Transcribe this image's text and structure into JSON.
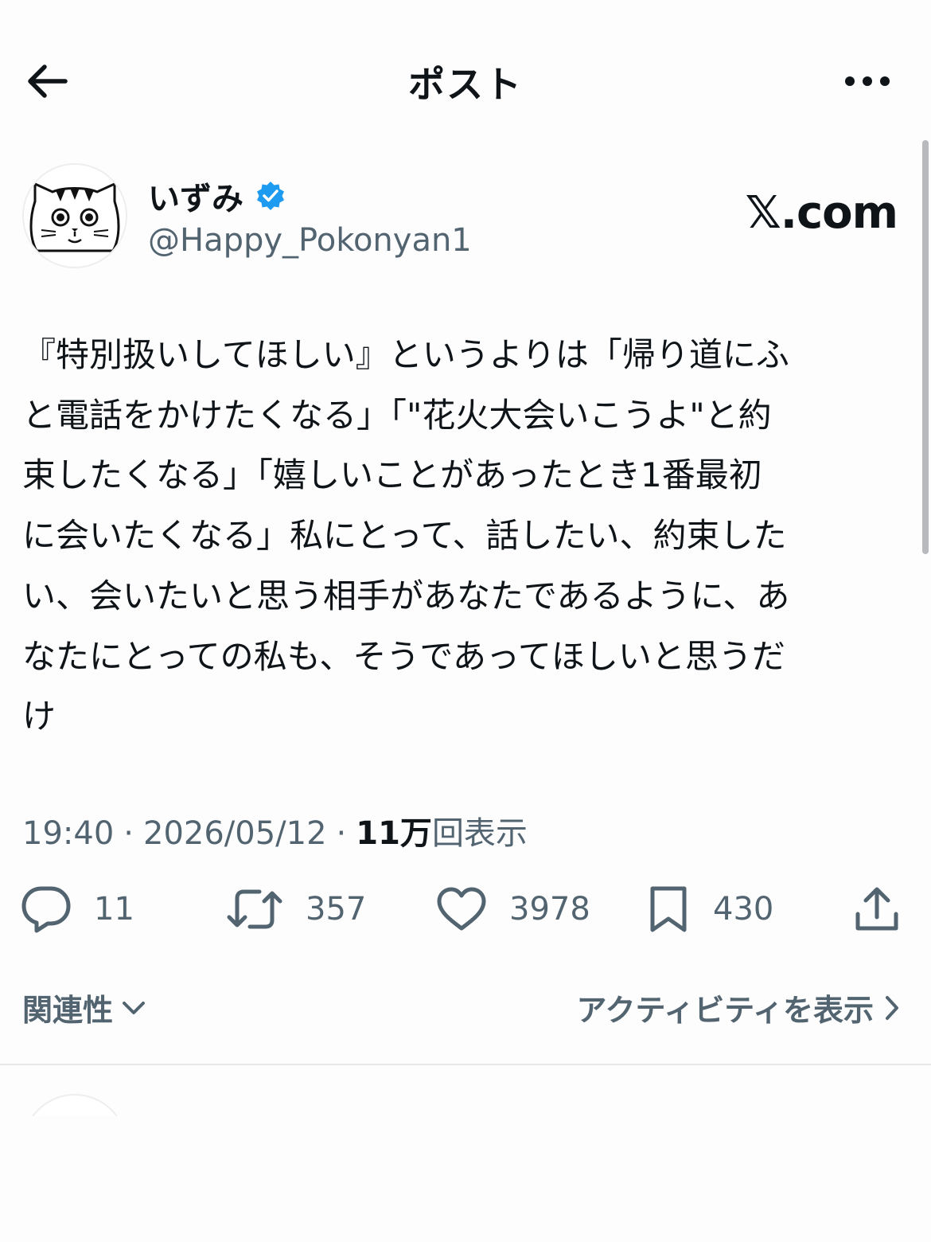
{
  "header": {
    "title": "ポスト",
    "back_icon": "arrow-left-icon",
    "more_icon": "more-dots-icon"
  },
  "author": {
    "display_name": "いずみ",
    "handle": "@Happy_Pokonyan1",
    "verified_icon": "verified-badge-icon",
    "verified_color": "#1d9bf0",
    "avatar": "cat-avatar"
  },
  "brand": {
    "logo": "𝕏.com"
  },
  "post": {
    "lines": [
      "『特別扱いしてほしい』というよりは「帰り道にふ",
      "と電話をかけたくなる」「\"花火大会いこうよ\"と約",
      "束したくなる」「嬉しいことがあったとき1番最初",
      "に会いたくなる」私にとって、話したい、約束した",
      "い、会いたいと思う相手があなたであるように、あ",
      "なたにとっての私も、そうであってほしいと思うだ",
      "け"
    ]
  },
  "meta": {
    "time": "19:40",
    "date": "2026/05/12",
    "views_count": "11万",
    "views_label": "回表示"
  },
  "actions": {
    "replies": "11",
    "reposts": "357",
    "likes": "3978",
    "bookmarks": "430"
  },
  "footer": {
    "related_label": "関連性",
    "activity_label": "アクティビティを表示"
  },
  "colors": {
    "text": "#0f1419",
    "secondary": "#536471",
    "background": "#fdfdfe"
  }
}
